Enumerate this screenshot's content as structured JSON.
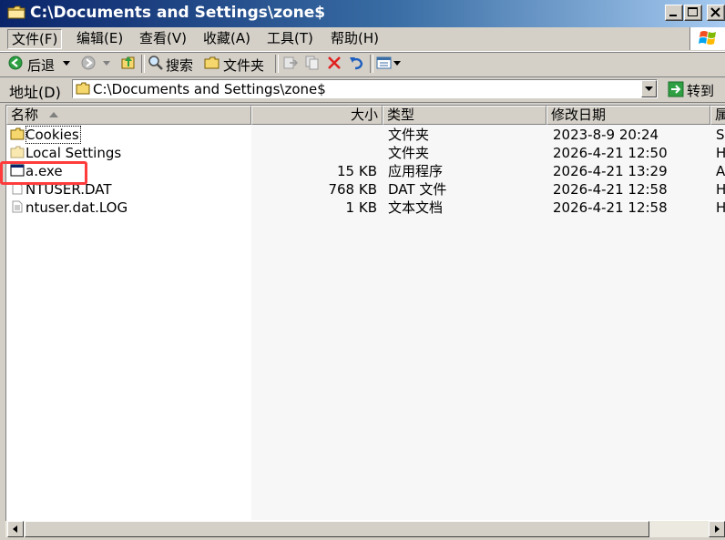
{
  "window": {
    "title": "C:\\Documents and Settings\\zone$"
  },
  "menu": {
    "file": "文件(F)",
    "edit": "编辑(E)",
    "view": "查看(V)",
    "favorites": "收藏(A)",
    "tools": "工具(T)",
    "help": "帮助(H)"
  },
  "toolbar": {
    "back_label": "后退",
    "search_label": "搜索",
    "folders_label": "文件夹"
  },
  "address": {
    "label": "地址(D)",
    "value": "C:\\Documents and Settings\\zone$",
    "go_label": "转到"
  },
  "columns": {
    "name": "名称",
    "size": "大小",
    "type": "类型",
    "modified": "修改日期",
    "attributes": "属"
  },
  "files": [
    {
      "name": "Cookies",
      "size": "",
      "type": "文件夹",
      "modified": "2023-8-9 20:24",
      "attr": "S",
      "icon": "folder-icon"
    },
    {
      "name": "Local Settings",
      "size": "",
      "type": "文件夹",
      "modified": "2026-4-21 12:50",
      "attr": "H",
      "icon": "folder-icon"
    },
    {
      "name": "a.exe",
      "size": "15 KB",
      "type": "应用程序",
      "modified": "2026-4-21 13:29",
      "attr": "A",
      "icon": "exe-icon"
    },
    {
      "name": "NTUSER.DAT",
      "size": "768 KB",
      "type": "DAT 文件",
      "modified": "2026-4-21 12:58",
      "attr": "H",
      "icon": "file-icon"
    },
    {
      "name": "ntuser.dat.LOG",
      "size": "1 KB",
      "type": "文本文档",
      "modified": "2026-4-21 12:58",
      "attr": "H",
      "icon": "text-file-icon"
    }
  ],
  "colors": {
    "title_gradient_start": "#0a246a",
    "title_gradient_end": "#a6caf0",
    "face": "#d4d0c8",
    "highlight": "#ff3b3b"
  }
}
